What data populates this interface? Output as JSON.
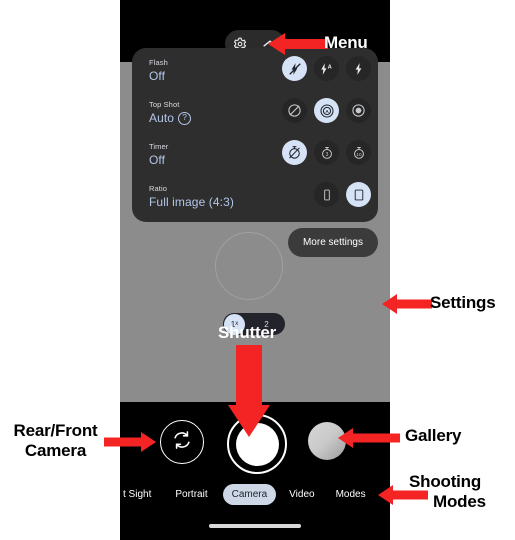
{
  "phone": {
    "topbar": {
      "menu_pill": {
        "gear_icon": "gear-icon",
        "chevron_icon": "chevron-up-icon"
      }
    },
    "settings_panel": {
      "rows": [
        {
          "label": "Flash",
          "value": "Off",
          "has_help": false,
          "options": [
            {
              "name": "flash-off-icon",
              "selected": true
            },
            {
              "name": "flash-auto-icon",
              "selected": false
            },
            {
              "name": "flash-on-icon",
              "selected": false
            }
          ]
        },
        {
          "label": "Top Shot",
          "value": "Auto",
          "has_help": true,
          "help_glyph": "?",
          "options": [
            {
              "name": "top-shot-off-icon",
              "selected": false
            },
            {
              "name": "top-shot-auto-icon",
              "selected": true
            },
            {
              "name": "top-shot-on-icon",
              "selected": false
            }
          ]
        },
        {
          "label": "Timer",
          "value": "Off",
          "has_help": false,
          "options": [
            {
              "name": "timer-off-icon",
              "selected": true
            },
            {
              "name": "timer-3s-icon",
              "selected": false,
              "text": "3"
            },
            {
              "name": "timer-10s-icon",
              "selected": false,
              "text": "10"
            }
          ]
        },
        {
          "label": "Ratio",
          "value": "Full image (4:3)",
          "has_help": false,
          "options": [
            {
              "name": "ratio-16-9-icon",
              "selected": false
            },
            {
              "name": "ratio-4-3-icon",
              "selected": true
            }
          ]
        }
      ]
    },
    "more_settings_label": "More settings",
    "zoom": {
      "options": [
        {
          "label": "1",
          "suffix": "x",
          "selected": true
        },
        {
          "label": "2",
          "suffix": "",
          "selected": false
        }
      ]
    },
    "controls": {
      "flip_camera_icon": "camera-flip-icon",
      "shutter_button": "shutter-button",
      "gallery_thumbnail": "gallery-thumbnail"
    },
    "shooting_modes": [
      {
        "label": "t Sight",
        "selected": false
      },
      {
        "label": "Portrait",
        "selected": false
      },
      {
        "label": "Camera",
        "selected": true
      },
      {
        "label": "Video",
        "selected": false
      },
      {
        "label": "Modes",
        "selected": false
      }
    ]
  },
  "annotations": {
    "menu": "Menu",
    "settings": "Settings",
    "gallery": "Gallery",
    "shutter": "Shutter",
    "rear_front_camera_line1": "Rear/Front",
    "rear_front_camera_line2": "Camera",
    "shooting_modes_line1": "Shooting",
    "shooting_modes_line2": "Modes",
    "arrow_color": "#f42424"
  }
}
